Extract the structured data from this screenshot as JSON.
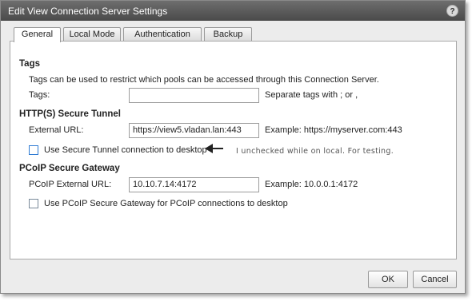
{
  "window": {
    "title": "Edit View Connection Server Settings",
    "help_label": "?"
  },
  "tabs": [
    {
      "label": "General",
      "active": true
    },
    {
      "label": "Local Mode",
      "active": false
    },
    {
      "label": "Authentication",
      "active": false
    },
    {
      "label": "Backup",
      "active": false
    }
  ],
  "tags_section": {
    "heading": "Tags",
    "description": "Tags can be used to restrict which pools can be accessed through this Connection Server.",
    "field_label": "Tags:",
    "value": "",
    "hint": "Separate tags with ; or ,"
  },
  "tunnel_section": {
    "heading": "HTTP(S) Secure Tunnel",
    "field_label": "External URL:",
    "value": "https://view5.vladan.lan:443",
    "example": "Example: https://myserver.com:443",
    "checkbox_label": "Use Secure Tunnel connection to desktop",
    "checked": false,
    "annotation": "I unchecked while on local. For testing."
  },
  "pcoip_section": {
    "heading": "PCoIP Secure Gateway",
    "field_label": "PCoIP External URL:",
    "value": "10.10.7.14:4172",
    "example": "Example: 10.0.0.1:4172",
    "checkbox_label": "Use PCoIP Secure Gateway for PCoIP connections to desktop",
    "checked": false
  },
  "footer": {
    "ok_label": "OK",
    "cancel_label": "Cancel"
  },
  "colors": {
    "titlebar": "#4a4a4a",
    "checkbox_focus": "#2f7bd3"
  }
}
